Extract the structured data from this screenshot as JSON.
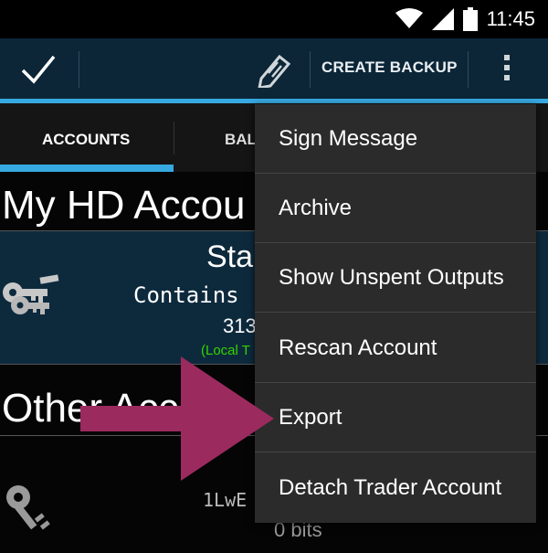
{
  "status_bar": {
    "time": "11:45",
    "icons": [
      "wifi-icon",
      "signal-icon",
      "battery-icon"
    ]
  },
  "action_bar": {
    "confirm_icon": "check-icon",
    "edit_icon": "edit-tag-icon",
    "create_backup_label": "CREATE BACKUP",
    "overflow_icon": "overflow-menu-icon"
  },
  "tabs": {
    "accounts_label": "ACCOUNTS",
    "balance_label": "BAL"
  },
  "main": {
    "hd_section_title": "My HD Accou",
    "hd_account": {
      "name": "Sta",
      "contains": "Contains",
      "value": "313",
      "local_note": "(Local T"
    },
    "other_section_title": "Other Acco",
    "other_account": {
      "address": "1LwE",
      "balance": "0 bits"
    }
  },
  "menu": {
    "items": [
      {
        "label": "Sign Message"
      },
      {
        "label": "Archive"
      },
      {
        "label": "Show Unspent Outputs"
      },
      {
        "label": "Rescan Account"
      },
      {
        "label": "Export"
      },
      {
        "label": "Detach Trader Account"
      }
    ]
  },
  "colors": {
    "accent": "#37a9e1",
    "action_bar": "#0c2637",
    "menu_bg": "#2b2b2b",
    "arrow": "#9b2a5e",
    "local_text": "#34d400"
  }
}
